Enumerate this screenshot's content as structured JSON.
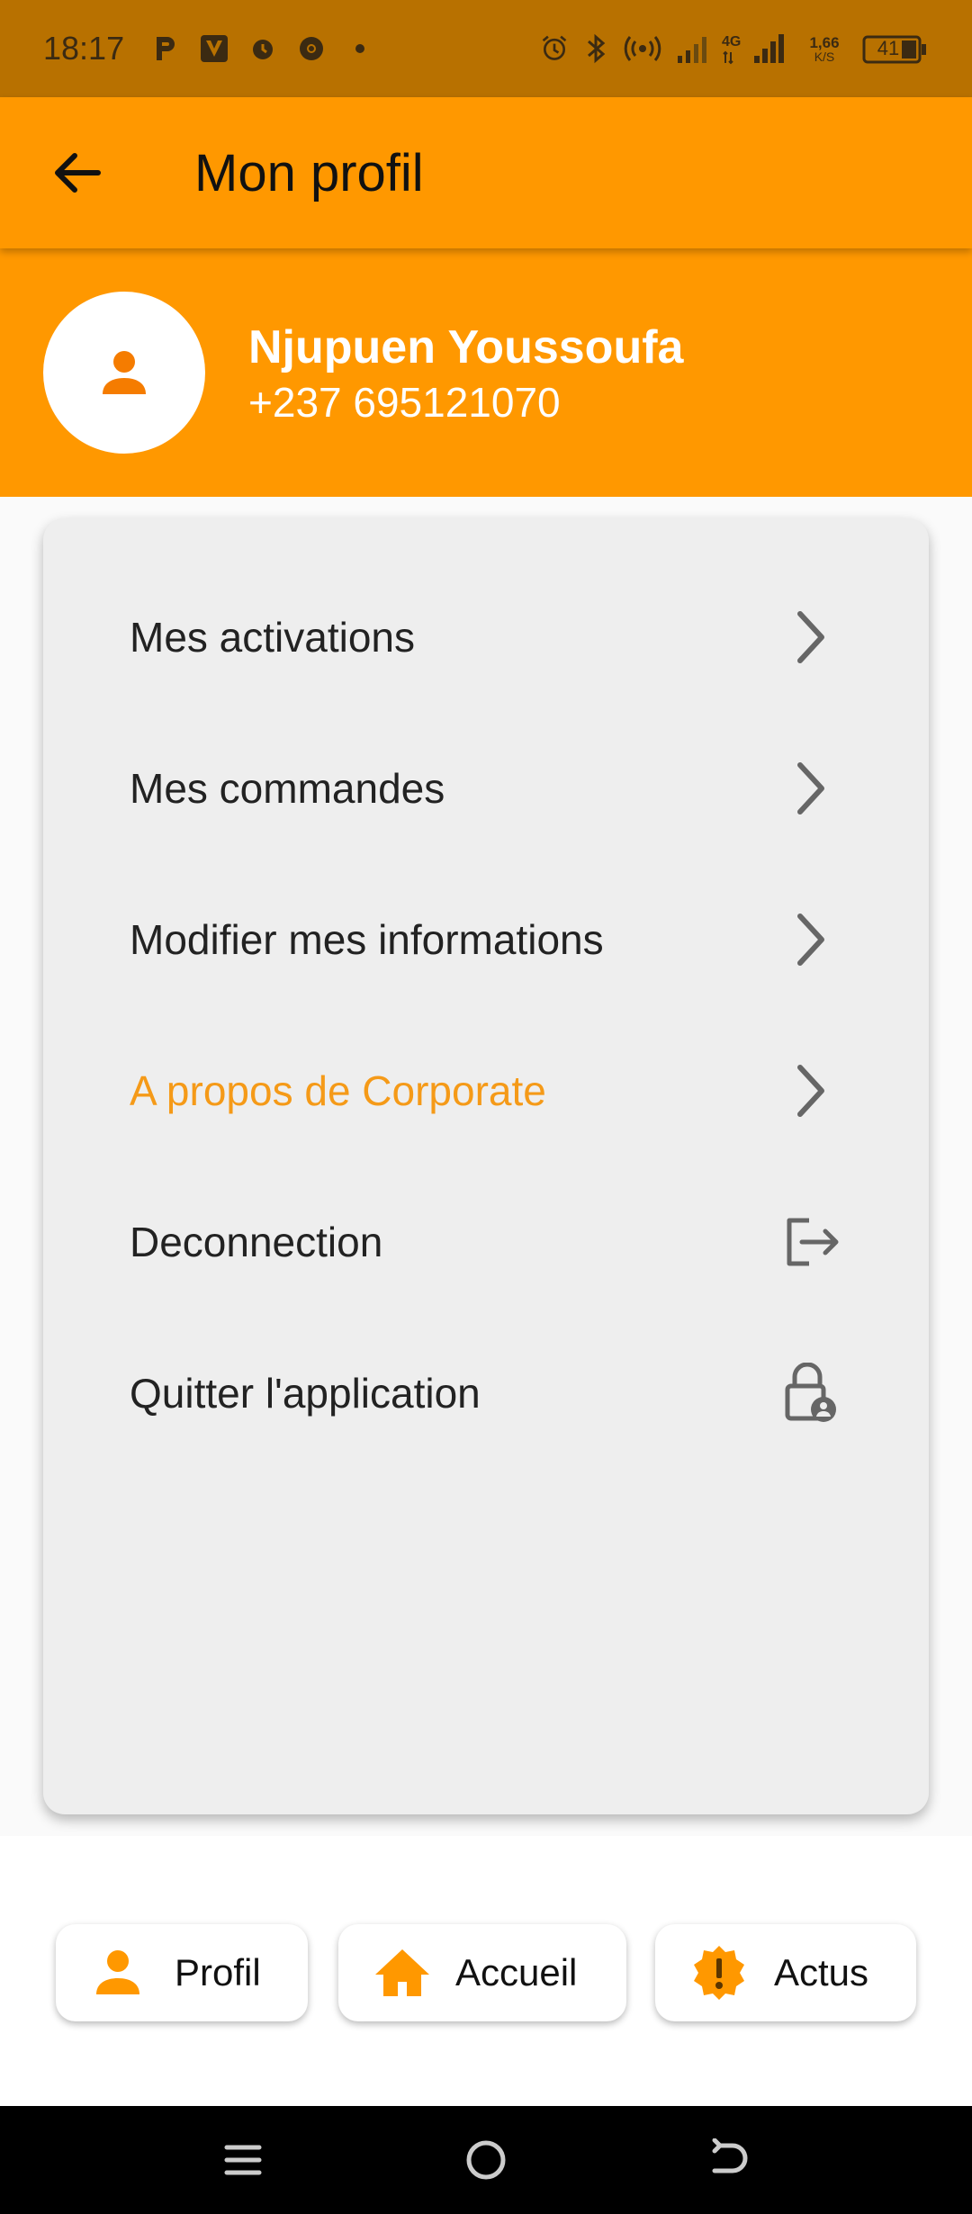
{
  "status_bar": {
    "time": "18:17",
    "left_icons": [
      "p-icon",
      "v-icon",
      "alarm-icon",
      "chrome-icon",
      "dot-icon"
    ],
    "right_icons": [
      "alarm-icon",
      "bluetooth-icon",
      "hotspot-icon",
      "signal-icon",
      "network-4g-icon",
      "signal-icon"
    ],
    "speed_value": "1,66",
    "speed_unit": "K/S",
    "battery": "41"
  },
  "app_bar": {
    "title": "Mon profil",
    "back_icon": "arrow-left-icon"
  },
  "profile": {
    "name": "Njupuen Youssoufa",
    "phone": "+237 695121070",
    "avatar_icon": "person-icon"
  },
  "menu": {
    "items": [
      {
        "label": "Mes activations",
        "icon": "chevron-right-icon",
        "accent": false
      },
      {
        "label": "Mes commandes",
        "icon": "chevron-right-icon",
        "accent": false
      },
      {
        "label": "Modifier mes informations",
        "icon": "chevron-right-icon",
        "accent": false
      },
      {
        "label": "A propos de Corporate",
        "icon": "chevron-right-icon",
        "accent": true
      },
      {
        "label": "Deconnection",
        "icon": "logout-icon",
        "accent": false
      },
      {
        "label": "Quitter l'application",
        "icon": "lock-person-icon",
        "accent": false
      }
    ]
  },
  "bottom_nav": {
    "items": [
      {
        "label": "Profil",
        "icon": "person-icon"
      },
      {
        "label": "Accueil",
        "icon": "home-icon"
      },
      {
        "label": "Actus",
        "icon": "alert-badge-icon"
      }
    ]
  },
  "system_nav": [
    "menu-icon",
    "home-circle-icon",
    "back-icon"
  ],
  "colors": {
    "primary": "#ff9800",
    "status_bar": "#b87100",
    "accent_text": "#f59a18",
    "card_bg": "#eeeeee"
  }
}
